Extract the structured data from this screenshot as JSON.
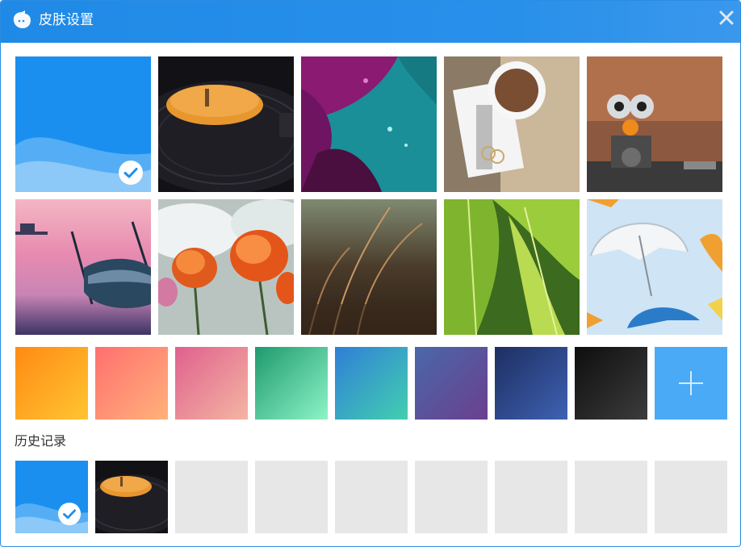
{
  "window": {
    "title": "皮肤设置"
  },
  "theme": {
    "titlebar_color": "#2a8de3",
    "accent_blue": "#1b8ff0"
  },
  "skins": [
    {
      "name": "blue-wave",
      "selected": true
    },
    {
      "name": "vinyl-record",
      "selected": false
    },
    {
      "name": "magenta-petal-teal-leaf",
      "selected": false
    },
    {
      "name": "coffee-cup-notebook",
      "selected": false
    },
    {
      "name": "robot-owl-toy",
      "selected": false
    },
    {
      "name": "sunset-lake-boat",
      "selected": false
    },
    {
      "name": "orange-poppies-sky",
      "selected": false
    },
    {
      "name": "wheat-grass",
      "selected": false
    },
    {
      "name": "green-leaf-drops",
      "selected": false
    },
    {
      "name": "umbrellas-sky",
      "selected": false
    }
  ],
  "colors": [
    {
      "name": "orange",
      "from": "#ff8a14",
      "to": "#ffc531"
    },
    {
      "name": "coral",
      "from": "#ff6f6f",
      "to": "#ffb27a"
    },
    {
      "name": "pink",
      "from": "#e0608e",
      "to": "#f4b6a2"
    },
    {
      "name": "green",
      "from": "#1e9a6e",
      "to": "#8ef4c6"
    },
    {
      "name": "teal",
      "from": "#2f7fd6",
      "to": "#43cfb0"
    },
    {
      "name": "purple",
      "from": "#4a68a8",
      "to": "#6b3f8f"
    },
    {
      "name": "navy",
      "from": "#1e2e62",
      "to": "#3e62b2"
    },
    {
      "name": "black",
      "from": "#0e0e0e",
      "to": "#3c3c3c"
    }
  ],
  "custom_skin_button": {
    "icon": "plus-icon",
    "color": "#4aaaf5"
  },
  "history": {
    "label": "历史记录",
    "items": [
      {
        "name": "blue-wave",
        "selected": true
      },
      {
        "name": "vinyl-record",
        "selected": false
      }
    ],
    "empty_slots": 7
  }
}
